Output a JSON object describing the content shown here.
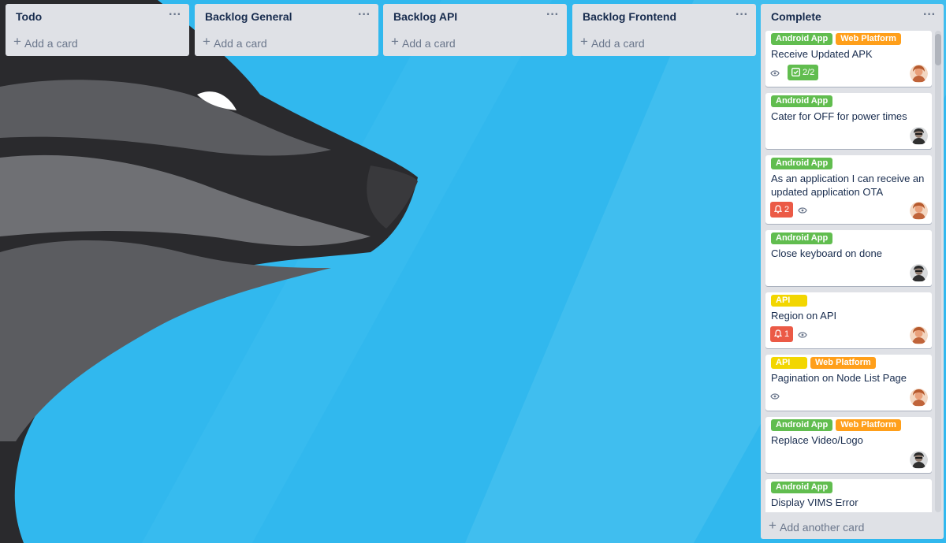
{
  "board": {
    "background_color": "#31b8ee",
    "lists": [
      {
        "title": "Todo",
        "menu": "···",
        "add_label": "Add a card"
      },
      {
        "title": "Backlog General",
        "menu": "···",
        "add_label": "Add a card"
      },
      {
        "title": "Backlog API",
        "menu": "···",
        "add_label": "Add a card"
      },
      {
        "title": "Backlog Frontend",
        "menu": "···",
        "add_label": "Add a card"
      }
    ],
    "complete": {
      "title": "Complete",
      "menu": "···",
      "add_label": "Add another card",
      "cards": [
        {
          "labels": [
            "Android App",
            "Web Platform"
          ],
          "title": "Receive Updated APK",
          "badges": {
            "watch": true,
            "checklist": "2/2"
          },
          "avatar": "avatar-orange"
        },
        {
          "labels": [
            "Android App"
          ],
          "title": "Cater for OFF for power times",
          "avatar": "avatar-dark"
        },
        {
          "labels": [
            "Android App"
          ],
          "title": "As an application I can receive an updated application OTA",
          "badges": {
            "due": "2",
            "watch": true
          },
          "avatar": "avatar-orange"
        },
        {
          "labels": [
            "Android App"
          ],
          "title": "Close keyboard on done",
          "avatar": "avatar-dark"
        },
        {
          "labels": [
            "API"
          ],
          "title": "Region on API",
          "badges": {
            "due": "1",
            "watch": true
          },
          "avatar": "avatar-orange"
        },
        {
          "labels": [
            "API",
            "Web Platform"
          ],
          "title": "Pagination on Node List Page",
          "badges": {
            "watch": true
          },
          "avatar": "avatar-orange"
        },
        {
          "labels": [
            "Android App",
            "Web Platform"
          ],
          "title": "Replace Video/Logo",
          "avatar": "avatar-dark"
        },
        {
          "labels": [
            "Android App"
          ],
          "title": "Display VIMS Error"
        }
      ]
    },
    "label_colors": {
      "Android App": "#61bd4f",
      "Web Platform": "#ff9f1a",
      "API": "#f2d600"
    }
  }
}
